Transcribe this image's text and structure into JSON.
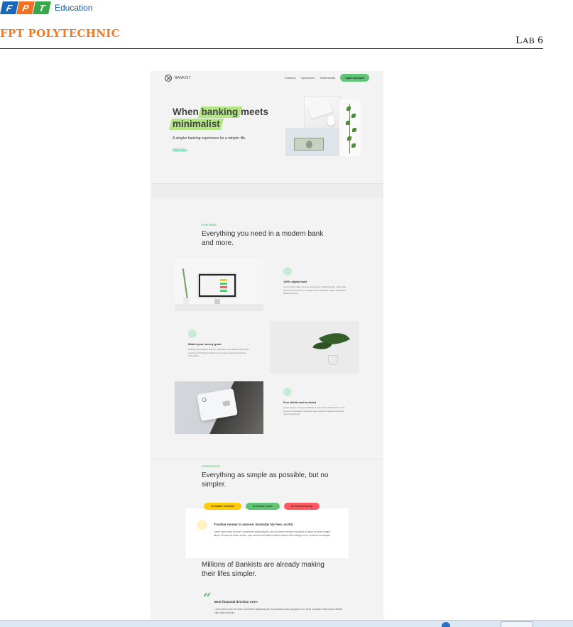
{
  "doc_header": {
    "logo_letters": [
      "F",
      "P",
      "T"
    ],
    "logo_suffix": "Education",
    "school_name": "FPT POLYTECHNIC",
    "lab_prefix_big": "L",
    "lab_prefix_small": "AB",
    "lab_number": "6",
    "colors": {
      "fpt_blue": "#1967b8",
      "fpt_orange": "#f36f21",
      "fpt_green": "#3aa84a"
    }
  },
  "site": {
    "brand": "BANKIST",
    "brand_icon": "bankist-logo-icon",
    "nav": {
      "links": [
        "Features",
        "Operations",
        "Testimonials"
      ],
      "cta": "Open account"
    },
    "hero": {
      "title_part1": "When ",
      "title_highlight1": "banking",
      "title_part2": " meets",
      "title_highlight2": "minimalist",
      "subtitle": "A simpler banking experience for a simpler life.",
      "link": "Learn more ↓"
    },
    "features": {
      "tag": "FEATURES",
      "title": "Everything you need in a modern bank and more.",
      "items": [
        {
          "title": "100% digital bank",
          "text": "Lorem ipsum dolor sit amet consectetur adipisicing elit. Unde alias sint quos? Accusantium a fugiat porro reiciendis saepe quibusdam debitis ducimus."
        },
        {
          "title": "Watch your money grow",
          "text": "Nesciunt quos autem dolorum voluptates cum dolores dicta fuga inventore ab? Nulla incidunt eius numquam sequi iste pariatur quibusdam!"
        },
        {
          "title": "Free debit card included",
          "text": "Quasi, fugit in cumque cupiditate reprehenderit debitis animi enim eveniet consequatur odit quam quos possimus assumenda dicta fuga inventore ab."
        }
      ]
    },
    "operations": {
      "tag": "OPERATIONS",
      "title": "Everything as simple as possible, but no simpler.",
      "tabs": [
        "01 Instant Transfers",
        "02 Instant Loans",
        "03 Instant Closing"
      ],
      "active_title": "Tranfser money to anyone, instantly! No fees, no BS.",
      "active_text": "Lorem ipsum dolor sit amet, consectetur adipisicing elit, sed do eiusmod tempor incididunt ut labore et dolore magna aliqua. Ut enim ad minim veniam, quis nostrud exercitation ullamco laboris nisi ut aliquip ex ea commodo consequat."
    },
    "testimonials": {
      "title": "Millions of Bankists are already making their lifes simpler.",
      "quote_mark": "“",
      "quote_title": "Best financial decision ever!",
      "quote_text": "Lorem ipsum dolor sit, amet consectetur adipisicing elit. Accusantium quas quisquam non? Quas voluptate nulla minima deleniti optio ullam nesciunt."
    },
    "colors": {
      "primary": "#5ec576",
      "highlight": "#9be15d",
      "tab_yellow": "#ffcb03",
      "tab_red": "#ff585f",
      "background": "#f3f3f3"
    }
  }
}
